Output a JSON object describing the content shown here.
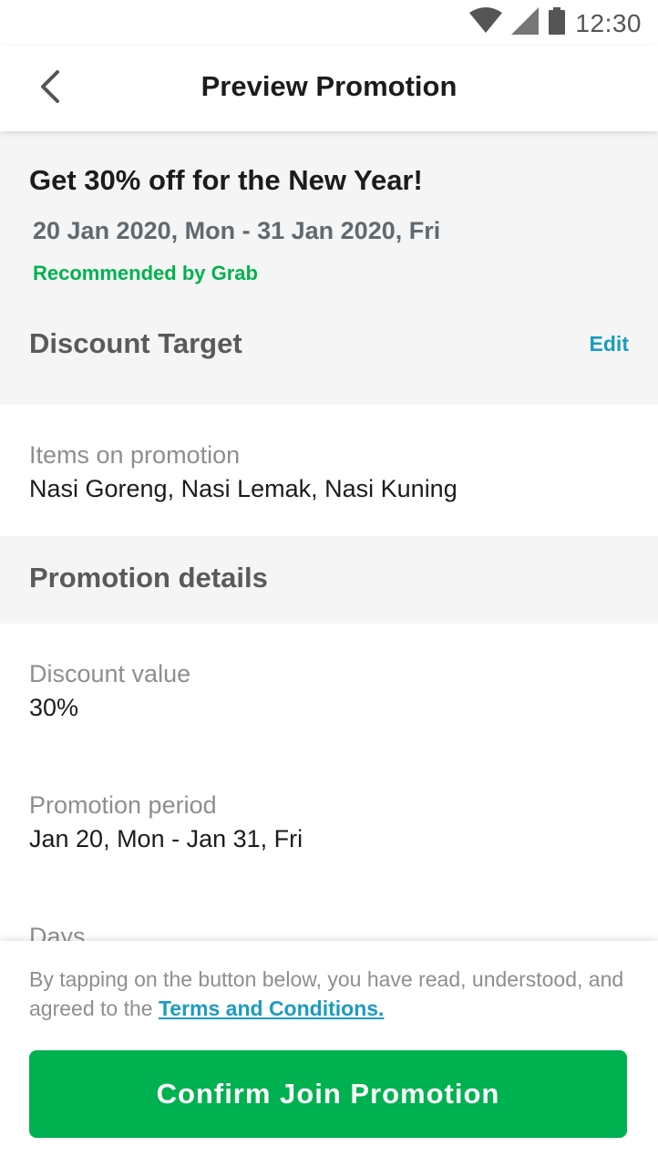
{
  "status_bar": {
    "time": "12:30",
    "icons": [
      "wifi-icon",
      "signal-icon",
      "battery-icon"
    ]
  },
  "app_bar": {
    "title": "Preview Promotion",
    "back_icon": "chevron-left-icon"
  },
  "promo": {
    "title": "Get 30% off for the New Year!",
    "dates": "20 Jan 2020, Mon - 31 Jan 2020, Fri",
    "recommended": "Recommended by Grab"
  },
  "discount_target": {
    "section_title": "Discount Target",
    "edit_label": "Edit",
    "items_label": "Items on promotion",
    "items_value": "Nasi Goreng, Nasi Lemak, Nasi Kuning"
  },
  "promotion_details": {
    "section_title": "Promotion details",
    "discount_label": "Discount value",
    "discount_value": "30%",
    "period_label": "Promotion period",
    "period_value": "Jan 20, Mon - Jan 31, Fri",
    "days_label": "Days"
  },
  "footer": {
    "terms_prefix": "By tapping on the button below, you have read, understood, and agreed to the ",
    "terms_link": "Terms and Conditions.",
    "confirm_label": "Confirm Join Promotion"
  },
  "colors": {
    "brand_green": "#00b14f",
    "link_blue": "#1b9bc2",
    "section_bg": "#f5f5f5"
  }
}
